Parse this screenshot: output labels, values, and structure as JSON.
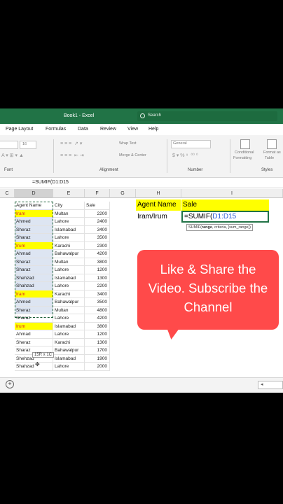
{
  "window": {
    "title": "Book1 - Excel"
  },
  "search": {
    "placeholder": "Search"
  },
  "tabs": [
    "Page Layout",
    "Formulas",
    "Data",
    "Review",
    "View",
    "Help"
  ],
  "ribbon": {
    "font_size": "16",
    "wrap_text": "Wrap Text",
    "merge_center": "Merge & Center",
    "number_format": "General",
    "conditional_formatting": [
      "Conditional",
      "Formatting"
    ],
    "format_as_table": [
      "Format as",
      "Table"
    ],
    "groups": {
      "font": "Font",
      "alignment": "Alignment",
      "number": "Number",
      "styles": "Styles"
    }
  },
  "formula_bar": {
    "value": "=SUMIF(D1:D15"
  },
  "columns": [
    "C",
    "D",
    "E",
    "F",
    "G",
    "H",
    "I"
  ],
  "table": {
    "headers": [
      "Agent Name",
      "City",
      "Sale"
    ],
    "rows": [
      {
        "agent": "Iram",
        "city": "Multan",
        "sale": "2200",
        "highlight": "yellow"
      },
      {
        "agent": "Ahmed",
        "city": "Lahore",
        "sale": "2400",
        "highlight": "shade"
      },
      {
        "agent": "Sheraz",
        "city": "Islamabad",
        "sale": "3400",
        "highlight": "shade"
      },
      {
        "agent": "Sharaz",
        "city": "Lahore",
        "sale": "3500",
        "highlight": "shade"
      },
      {
        "agent": "Irum",
        "city": "Karachi",
        "sale": "2300",
        "highlight": "yellow"
      },
      {
        "agent": "Ahmad",
        "city": "Bahawalpur",
        "sale": "4200",
        "highlight": "shade"
      },
      {
        "agent": "Sheraz",
        "city": "Multan",
        "sale": "3800",
        "highlight": "shade"
      },
      {
        "agent": "Sharaz",
        "city": "Lahore",
        "sale": "1200",
        "highlight": "shade"
      },
      {
        "agent": "Shehzad",
        "city": "Islamabad",
        "sale": "1300",
        "highlight": "shade"
      },
      {
        "agent": "Shahzad",
        "city": "Lahore",
        "sale": "2200",
        "highlight": "shade"
      },
      {
        "agent": "Iram",
        "city": "Karachi",
        "sale": "3400",
        "highlight": "yellow"
      },
      {
        "agent": "Ahmed",
        "city": "Bahawalpur",
        "sale": "3500",
        "highlight": "shade"
      },
      {
        "agent": "Sheraz",
        "city": "Multan",
        "sale": "4800",
        "highlight": "shade"
      },
      {
        "agent": "Sharaz",
        "city": "Lahore",
        "sale": "4200",
        "highlight": "none"
      },
      {
        "agent": "Irum",
        "city": "Islamabad",
        "sale": "3800",
        "highlight": "yellow"
      },
      {
        "agent": "Ahmad",
        "city": "Lahore",
        "sale": "1200",
        "highlight": "none"
      },
      {
        "agent": "Sheraz",
        "city": "Karachi",
        "sale": "1300",
        "highlight": "none"
      },
      {
        "agent": "Sharaz",
        "city": "Bahawalpur",
        "sale": "1700",
        "highlight": "none"
      },
      {
        "agent": "Shehzad",
        "city": "Islamabad",
        "sale": "1900",
        "highlight": "none"
      },
      {
        "agent": "Shahzad",
        "city": "Lahore",
        "sale": "2000",
        "highlight": "none"
      }
    ]
  },
  "selection_tooltip": "15R x 1C",
  "criteria": {
    "agent_label": "Agent Name",
    "sale_label": "Sale",
    "agent_value": "Iram/Irum",
    "formula_prefix": "=SUMIF(",
    "formula_ref": "D1:D15"
  },
  "function_hint": {
    "name": "SUMIF(",
    "arg1": "range",
    "rest": ", criteria, [sum_range])"
  },
  "callout": {
    "text": "Like & Share the Video. Subscribe the Channel"
  },
  "colors": {
    "excel_green": "#217346",
    "highlight_yellow": "#ffff00",
    "callout_red": "#ff4a4a"
  }
}
